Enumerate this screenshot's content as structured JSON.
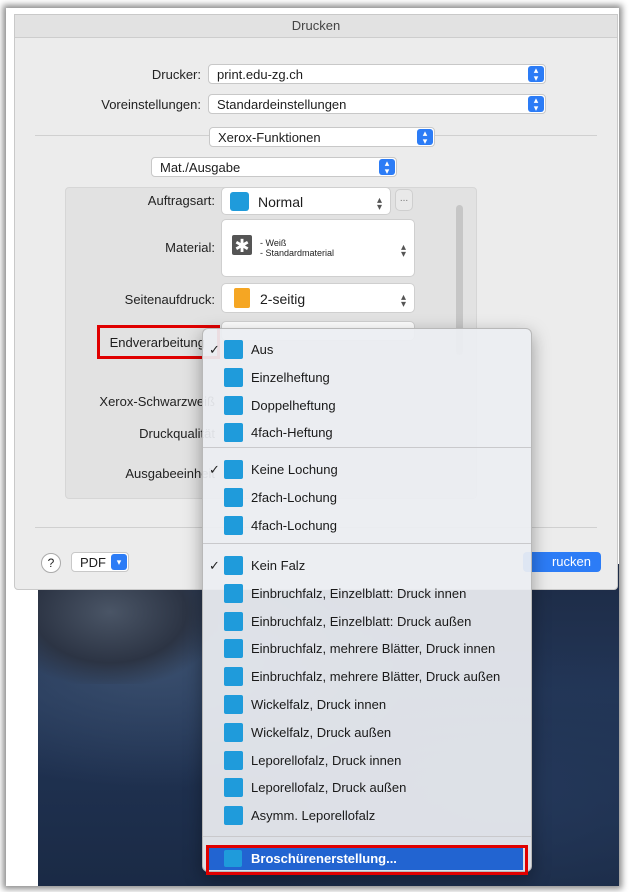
{
  "window": {
    "title": "Drucken"
  },
  "printer": {
    "label": "Drucker:",
    "value": "print.edu-zg.ch"
  },
  "presets": {
    "label": "Voreinstellungen:",
    "value": "Standardeinstellungen"
  },
  "section_popup": {
    "value": "Xerox-Funktionen"
  },
  "subsection_popup": {
    "value": "Mat./Ausgabe"
  },
  "job_type": {
    "label": "Auftragsart:",
    "value": "Normal",
    "more": "..."
  },
  "material": {
    "label": "Material:",
    "line1": "- Weiß",
    "line2": "- Standardmaterial"
  },
  "duplex": {
    "label": "Seitenaufdruck:",
    "value": "2-seitig"
  },
  "finishing": {
    "label": "Endverarbeitung",
    "value": "...us"
  },
  "xerox_bw": {
    "label": "Xerox-Schwarzweiß"
  },
  "print_quality": {
    "label": "Druckqualität"
  },
  "output_unit": {
    "label": "Ausgabeeinheit"
  },
  "footer": {
    "help": "?",
    "pdf": "PDF",
    "print_button": "rucken"
  },
  "menu": {
    "stapling": [
      {
        "label": "Aus",
        "checked": true,
        "icon": "no-staple-icon"
      },
      {
        "label": "Einzelheftung",
        "checked": false,
        "icon": "single-staple-icon"
      },
      {
        "label": "Doppelheftung",
        "checked": false,
        "icon": "double-staple-icon"
      },
      {
        "label": "4fach-Heftung",
        "checked": false,
        "icon": "quad-staple-icon"
      }
    ],
    "punching": [
      {
        "label": "Keine Lochung",
        "checked": true,
        "icon": "no-punch-icon"
      },
      {
        "label": "2fach-Lochung",
        "checked": false,
        "icon": "two-hole-punch-icon"
      },
      {
        "label": "4fach-Lochung",
        "checked": false,
        "icon": "four-hole-punch-icon"
      }
    ],
    "folding": [
      {
        "label": "Kein Falz",
        "checked": true,
        "icon": "no-fold-icon"
      },
      {
        "label": "Einbruchfalz, Einzelblatt: Druck innen",
        "checked": false,
        "icon": "fold-icon"
      },
      {
        "label": "Einbruchfalz, Einzelblatt: Druck außen",
        "checked": false,
        "icon": "fold-icon"
      },
      {
        "label": "Einbruchfalz, mehrere Blätter, Druck innen",
        "checked": false,
        "icon": "fold-icon"
      },
      {
        "label": "Einbruchfalz, mehrere Blätter, Druck außen",
        "checked": false,
        "icon": "fold-icon"
      },
      {
        "label": "Wickelfalz, Druck innen",
        "checked": false,
        "icon": "fold-icon"
      },
      {
        "label": "Wickelfalz, Druck außen",
        "checked": false,
        "icon": "fold-icon"
      },
      {
        "label": "Leporellofalz, Druck innen",
        "checked": false,
        "icon": "fold-icon"
      },
      {
        "label": "Leporellofalz, Druck außen",
        "checked": false,
        "icon": "fold-icon"
      },
      {
        "label": "Asymm. Leporellofalz",
        "checked": false,
        "icon": "fold-icon"
      }
    ],
    "booklet": {
      "label": "Broschürenerstellung...",
      "icon": "booklet-icon"
    }
  },
  "colors": {
    "accent": "#2264d1",
    "icon_blue": "#1f9bdb",
    "highlight_red": "#e00000"
  }
}
